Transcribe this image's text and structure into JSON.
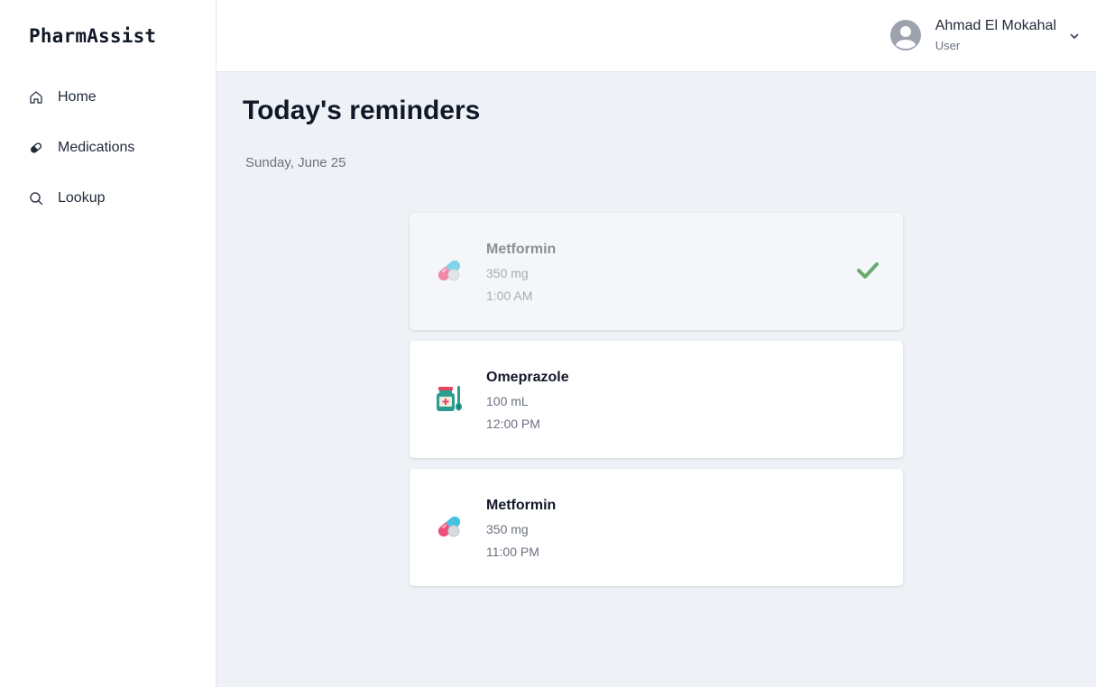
{
  "app": {
    "brand": "PharmAssist"
  },
  "sidebar": {
    "items": [
      {
        "label": "Home",
        "icon": "home-icon"
      },
      {
        "label": "Medications",
        "icon": "pill-icon"
      },
      {
        "label": "Lookup",
        "icon": "search-icon"
      }
    ]
  },
  "header": {
    "user": {
      "name": "Ahmad El Mokahal",
      "role": "User",
      "icon": "user-avatar-icon"
    }
  },
  "main": {
    "title": "Today's reminders",
    "date": "Sunday, June 25",
    "reminders": [
      {
        "name": "Metformin",
        "dose": "350 mg",
        "time": "1:00 AM",
        "icon": "capsule-icon",
        "taken": true
      },
      {
        "name": "Omeprazole",
        "dose": "100 mL",
        "time": "12:00 PM",
        "icon": "syrup-bottle-icon",
        "taken": false
      },
      {
        "name": "Metformin",
        "dose": "350 mg",
        "time": "11:00 PM",
        "icon": "capsule-icon",
        "taken": false
      }
    ]
  },
  "colors": {
    "check": "#6aaa6d",
    "background": "#eef1f5",
    "taken_card": "#f4f6f9"
  }
}
